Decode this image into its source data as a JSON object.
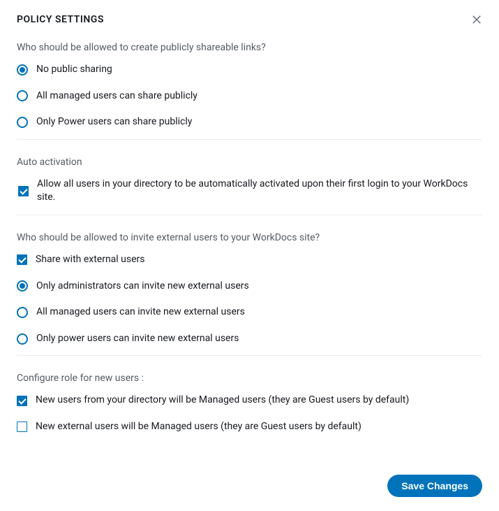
{
  "title": "POLICY SETTINGS",
  "sections": {
    "public_sharing": {
      "question": "Who should be allowed to create publicly shareable links?",
      "options": {
        "no_public": "No public sharing",
        "all_managed": "All managed users can share publicly",
        "power_users": "Only Power users can share publicly"
      }
    },
    "auto_activation": {
      "label": "Auto activation",
      "option": "Allow all users in your directory to be automatically activated upon their first login to your WorkDocs site."
    },
    "external_users": {
      "question": "Who should be allowed to invite external users to your WorkDocs site?",
      "share_external": "Share with external users",
      "options": {
        "admins_only": "Only administrators can invite new external users",
        "all_managed": "All managed users can invite new external users",
        "power_users": "Only power users can invite new external users"
      }
    },
    "new_users_role": {
      "label": "Configure role for new users :",
      "options": {
        "directory_managed": "New users from your directory will be Managed users (they are Guest users by default)",
        "external_managed": "New external users will be Managed users (they are Guest users by default)"
      }
    }
  },
  "footer": {
    "save_label": "Save Changes"
  }
}
